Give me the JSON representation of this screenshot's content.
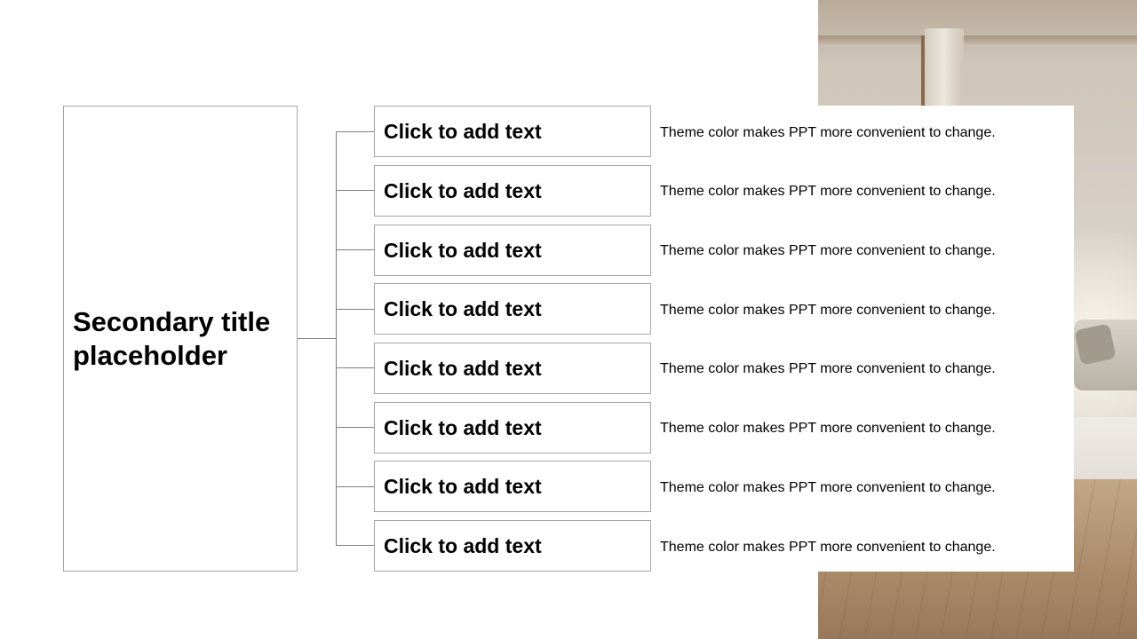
{
  "slide": {
    "title": "Secondary title placeholder",
    "items": [
      {
        "label": "Click to add text",
        "description": "Theme color makes PPT more convenient to change."
      },
      {
        "label": "Click to add text",
        "description": "Theme color makes PPT more convenient to change."
      },
      {
        "label": "Click to add text",
        "description": "Theme color makes PPT more convenient to change."
      },
      {
        "label": "Click to add text",
        "description": "Theme color makes PPT more convenient to change."
      },
      {
        "label": "Click to add text",
        "description": "Theme color makes PPT more convenient to change."
      },
      {
        "label": "Click to add text",
        "description": "Theme color makes PPT more convenient to change."
      },
      {
        "label": "Click to add text",
        "description": "Theme color makes PPT more convenient to change."
      },
      {
        "label": "Click to add text",
        "description": "Theme color makes PPT more convenient to change."
      }
    ]
  },
  "colors": {
    "border": "#a6a6a6",
    "connector": "#7f7f7f",
    "text": "#000000",
    "background": "#ffffff"
  },
  "background_image": "interior-room-photo"
}
